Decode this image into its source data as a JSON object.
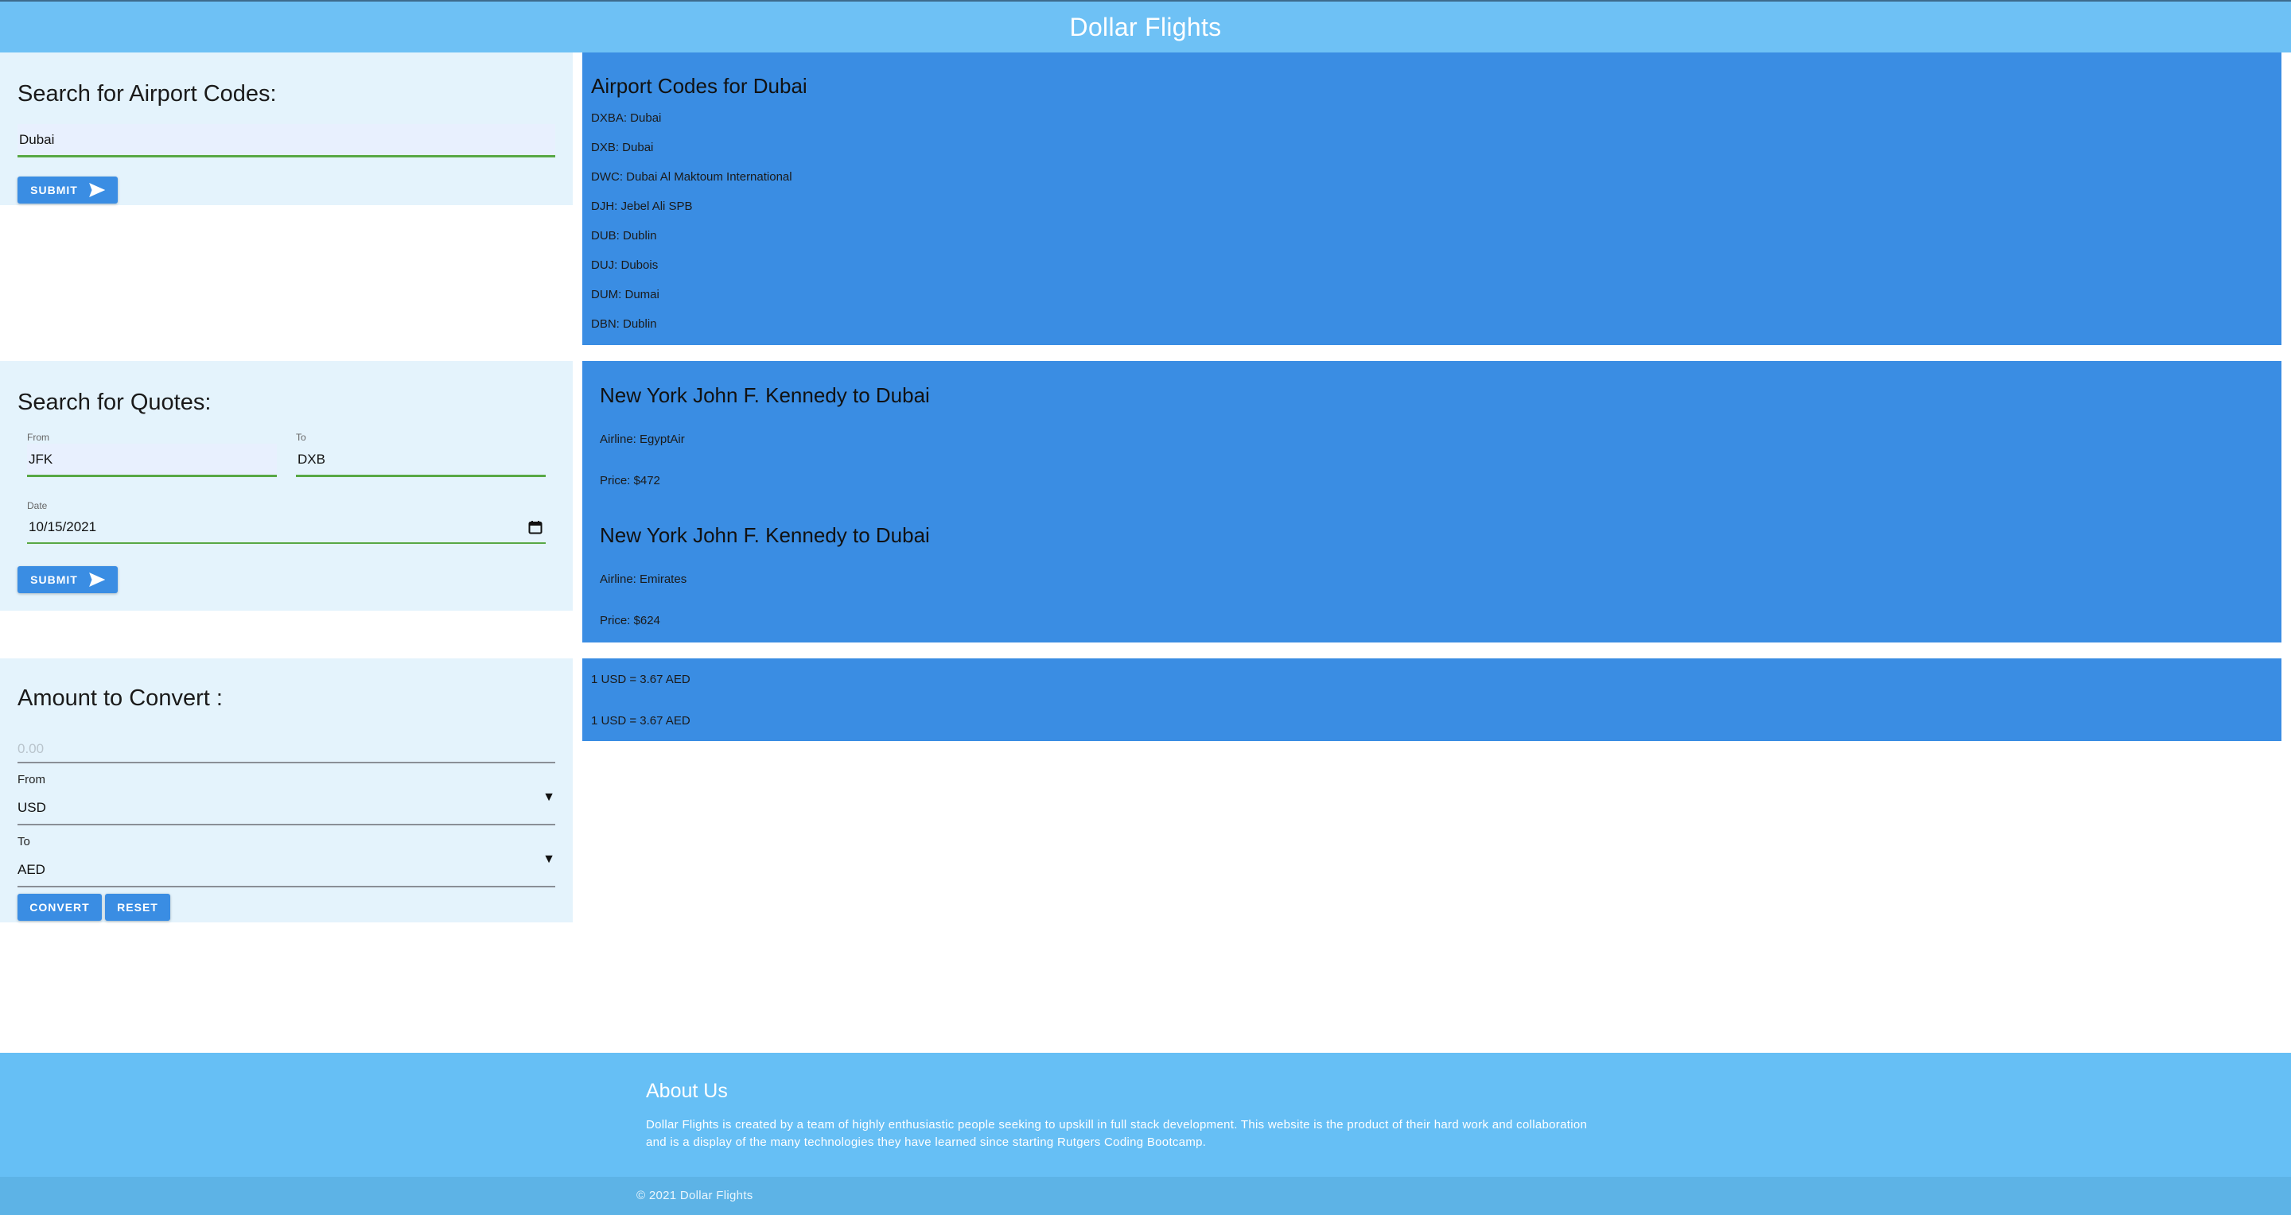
{
  "header": {
    "title": "Dollar Flights"
  },
  "airport_search": {
    "heading": "Search for Airport Codes:",
    "query": "Dubai",
    "submit_label": "SUBMIT"
  },
  "airport_results": {
    "title": "Airport Codes for Dubai",
    "codes": [
      "DXBA: Dubai",
      "DXB: Dubai",
      "DWC: Dubai Al Maktoum International",
      "DJH: Jebel Ali SPB",
      "DUB: Dublin",
      "DUJ: Dubois",
      "DUM: Dumai",
      "DBN: Dublin"
    ]
  },
  "quote_search": {
    "heading": "Search for Quotes:",
    "from_label": "From",
    "from_value": "JFK",
    "to_label": "To",
    "to_value": "DXB",
    "date_label": "Date",
    "date_value": "10/15/2021",
    "submit_label": "SUBMIT"
  },
  "quote_results": [
    {
      "route": "New York John F. Kennedy to Dubai",
      "airline": "Airline: EgyptAir",
      "price": "Price: $472"
    },
    {
      "route": "New York John F. Kennedy to Dubai",
      "airline": "Airline: Emirates",
      "price": "Price: $624"
    }
  ],
  "converter": {
    "heading": "Amount to Convert :",
    "amount_placeholder": "0.00",
    "from_label": "From",
    "from_value": "USD",
    "to_label": "To",
    "to_value": "AED",
    "convert_label": "CONVERT",
    "reset_label": "RESET"
  },
  "conversion_results": [
    "1 USD = 3.67 AED",
    "1 USD = 3.67 AED"
  ],
  "footer": {
    "about_title": "About Us",
    "about_text": "Dollar Flights is created by a team of highly enthusiastic people seeking to upskill in full stack development. This website is the product of their hard work and collaboration and is a display of the many technologies they have learned since starting Rutgers Coding Bootcamp.",
    "copyright": "© 2021 Dollar Flights"
  },
  "icons": {
    "submit": "send-icon",
    "date": "calendar-icon",
    "select": "caret-down-icon"
  },
  "colors": {
    "header": "#6ec1f5",
    "panel": "#e4f3fc",
    "results": "#3a8de3",
    "footer": "#66bff5",
    "copybar": "#5db3e6"
  }
}
